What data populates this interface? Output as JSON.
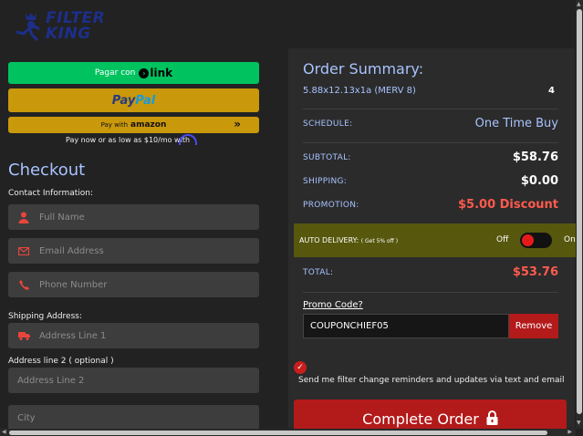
{
  "brand": {
    "line1": "FILTER",
    "line2": "KING"
  },
  "payments": {
    "link_prefix": "Pagar con",
    "link_logo": "link",
    "paypal_a": "Pay",
    "paypal_b": "Pal",
    "amazon_prefix": "Pay with",
    "amazon_logo": "amazon",
    "amazon_chevron": "»",
    "paynow": "Pay now or as low as $10/mo with"
  },
  "checkout": {
    "title": "Checkout",
    "contact_label": "Contact Information:",
    "full_name_placeholder": "Full Name",
    "email_placeholder": "Email Address",
    "phone_placeholder": "Phone Number",
    "shipping_label": "Shipping Address:",
    "address1_placeholder": "Address Line 1",
    "address2_label": "Address line 2 ( optional )",
    "address2_placeholder": "Address Line 2",
    "city_placeholder": "City"
  },
  "summary": {
    "title": "Order Summary:",
    "product_name": "5.88x12.13x1a (MERV 8)",
    "product_qty": "4",
    "schedule_label": "SCHEDULE:",
    "schedule_value": "One Time Buy",
    "subtotal_label": "SUBTOTAL:",
    "subtotal_value": "$58.76",
    "shipping_label": "SHIPPING:",
    "shipping_value": "$0.00",
    "promotion_label": "PROMOTION:",
    "promotion_value": "$5.00 Discount",
    "auto_delivery_label": "AUTO DELIVERY:",
    "auto_delivery_note": "( Get 5% off )",
    "toggle_off": "Off",
    "toggle_on": "On",
    "total_label": "TOTAL:",
    "total_value": "$53.76",
    "promo_label": "Promo Code?",
    "promo_value": "COUPONCHIEF05",
    "remove_label": "Remove",
    "reminder_text": "Send me filter change reminders and updates via text and email",
    "complete_label": "Complete Order"
  },
  "colors": {
    "accent_blue": "#a8c3ff",
    "danger_red": "#b31a1a",
    "paypal_gold": "#c9980b",
    "link_green": "#00c360"
  }
}
